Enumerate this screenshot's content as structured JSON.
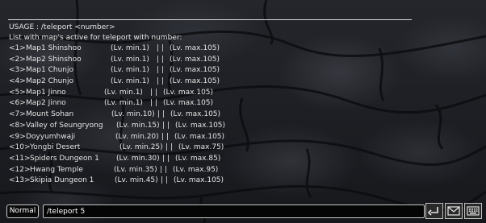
{
  "chat": {
    "usage": "USAGE : /teleport <number>",
    "intro": "List with map's active for teleport with number:",
    "maps": [
      {
        "num": "<1>",
        "name": "Map1 Shinshoo",
        "min": "(Lv. min.1)",
        "max": "(Lv. max.105)"
      },
      {
        "num": "<2>",
        "name": "Map2 Shinshoo",
        "min": "(Lv. min.1)",
        "max": "(Lv. max.105)"
      },
      {
        "num": "<3>",
        "name": "Map1 Chunjo",
        "min": "(Lv. min.1)",
        "max": "(Lv. max.105)"
      },
      {
        "num": "<4>",
        "name": "Map2 Chunjo",
        "min": "(Lv. min.1)",
        "max": "(Lv. max.105)"
      },
      {
        "num": "<5>",
        "name": "Map1 Jinno",
        "min": "(Lv. min.1)",
        "max": "(Lv. max.105)"
      },
      {
        "num": "<6>",
        "name": "Map2 Jinno",
        "min": "(Lv. min.1)",
        "max": "(Lv. max.105)"
      },
      {
        "num": "<7>",
        "name": "Mount Sohan",
        "min": "(Lv. min.10)",
        "max": "(Lv. max.105)"
      },
      {
        "num": "<8>",
        "name": "Valley of Seungryong",
        "min": "(Lv. min.15)",
        "max": "(Lv. max.105)"
      },
      {
        "num": "<9>",
        "name": "Doyyumhwaji",
        "min": "(Lv. min.20)",
        "max": "(Lv. max.105)"
      },
      {
        "num": "<10>",
        "name": "Yongbi Desert",
        "min": "(Lv. min.25)",
        "max": "(Lv. max.75)"
      },
      {
        "num": "<11>",
        "name": "Spiders Dungeon 1",
        "min": "(Lv. min.30)",
        "max": "(Lv. max.85)"
      },
      {
        "num": "<12>",
        "name": "Hwang Temple",
        "min": "(Lv. min.35)",
        "max": "(Lv. max.95)"
      },
      {
        "num": "<13>",
        "name": "Skipia Dungeon 1",
        "min": "(Lv. min.45)",
        "max": "(Lv. max.105)"
      }
    ],
    "separator": "| |"
  },
  "input_bar": {
    "mode_label": "Normal",
    "input_value": "/teleport 5"
  },
  "icons": [
    "enter-icon",
    "envelope-icon",
    "keyboard-icon"
  ]
}
